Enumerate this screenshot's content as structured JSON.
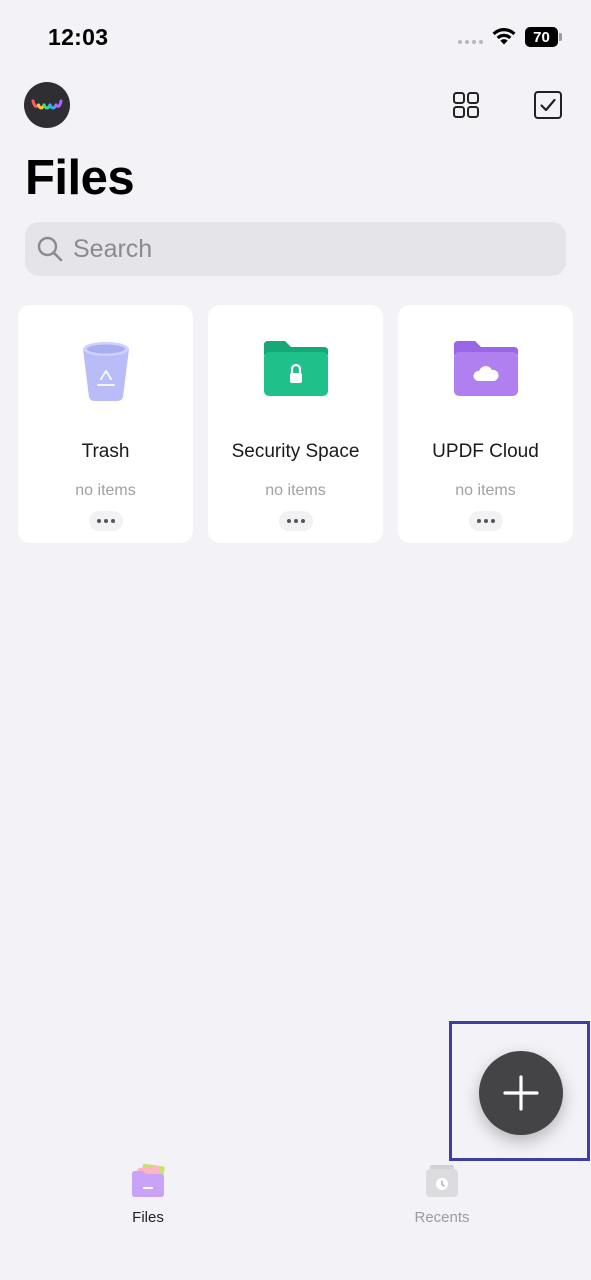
{
  "status_bar": {
    "time": "12:03",
    "battery": "70",
    "icons": [
      "signal-dots-icon",
      "wifi-icon",
      "battery-icon"
    ]
  },
  "header": {
    "avatar_icon": "app-logo-avatar",
    "grid_icon": "grid-view-icon",
    "select_icon": "checkbox-select-icon"
  },
  "page": {
    "title": "Files"
  },
  "search": {
    "placeholder": "Search",
    "value": "",
    "icon": "search-icon"
  },
  "folders": [
    {
      "label": "Trash",
      "subtitle": "no items",
      "icon": "trash-bin-icon",
      "color": "#b9bcf7"
    },
    {
      "label": "Security Space",
      "subtitle": "no items",
      "icon": "lock-folder-icon",
      "color": "#1fc08a"
    },
    {
      "label": "UPDF Cloud",
      "subtitle": "no items",
      "icon": "cloud-folder-icon",
      "color": "#b07ff0"
    }
  ],
  "fab": {
    "icon": "plus-icon",
    "highlight_color": "#3f3fa0"
  },
  "tabs": [
    {
      "label": "Files",
      "icon": "files-tab-icon",
      "active": true
    },
    {
      "label": "Recents",
      "icon": "recents-tab-icon",
      "active": false
    }
  ],
  "colors": {
    "background": "#f2f2f7",
    "fab": "#444446"
  }
}
